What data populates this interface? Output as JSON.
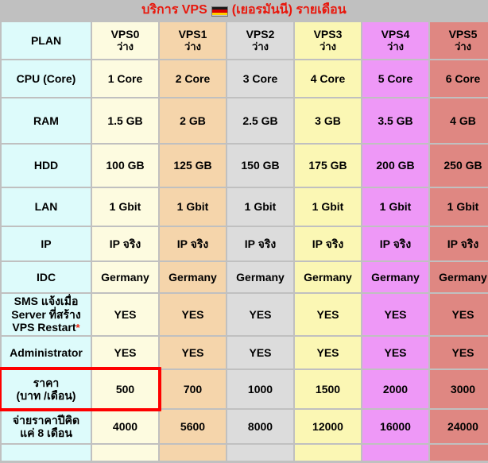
{
  "header": {
    "title_prefix": "บริการ VPS",
    "flag_icon": "german-flag-icon",
    "title_suffix": "(เยอรมันนี) รายเดือน",
    "accent_color": "#e8170c",
    "band_color": "#c0c0c0"
  },
  "columns": [
    {
      "key": "label",
      "name": "PLAN",
      "status": "",
      "color": "#ddfbfb"
    },
    {
      "key": "vps0",
      "name": "VPS0",
      "status": "ว่าง",
      "color": "#fdfbe0"
    },
    {
      "key": "vps1",
      "name": "VPS1",
      "status": "ว่าง",
      "color": "#f5d5ab"
    },
    {
      "key": "vps2",
      "name": "VPS2",
      "status": "ว่าง",
      "color": "#dcdcdc"
    },
    {
      "key": "vps3",
      "name": "VPS3",
      "status": "ว่าง",
      "color": "#fbf7b4"
    },
    {
      "key": "vps4",
      "name": "VPS4",
      "status": "ว่าง",
      "color": "#ee98f7"
    },
    {
      "key": "vps5",
      "name": "VPS5",
      "status": "ว่าง",
      "color": "#df8782"
    }
  ],
  "rows": [
    {
      "label": "CPU (Core)",
      "values": [
        "1 Core",
        "2 Core",
        "3 Core",
        "4 Core",
        "5 Core",
        "6 Core"
      ]
    },
    {
      "label": "RAM",
      "values": [
        "1.5 GB",
        "2 GB",
        "2.5 GB",
        "3 GB",
        "3.5 GB",
        "4 GB"
      ]
    },
    {
      "label": "HDD",
      "values": [
        "100 GB",
        "125 GB",
        "150 GB",
        "175 GB",
        "200 GB",
        "250 GB"
      ]
    },
    {
      "label": "LAN",
      "values": [
        "1 Gbit",
        "1 Gbit",
        "1 Gbit",
        "1 Gbit",
        "1 Gbit",
        "1 Gbit"
      ]
    },
    {
      "label": "IP",
      "values": [
        "IP จริง",
        "IP จริง",
        "IP จริง",
        "IP จริง",
        "IP จริง",
        "IP จริง"
      ]
    },
    {
      "label": "IDC",
      "values": [
        "Germany",
        "Germany",
        "Germany",
        "Germany",
        "Germany",
        "Germany"
      ]
    },
    {
      "label_lines": [
        "SMS แจ้งเมื่อ",
        "Server ที่สร้าง",
        "VPS Restart"
      ],
      "label_star": "*",
      "values": [
        "YES",
        "YES",
        "YES",
        "YES",
        "YES",
        "YES"
      ]
    },
    {
      "label": "Administrator",
      "values": [
        "YES",
        "YES",
        "YES",
        "YES",
        "YES",
        "YES"
      ]
    },
    {
      "label_lines": [
        "ราคา",
        "(บาท /เดือน)"
      ],
      "values": [
        "500",
        "700",
        "1000",
        "1500",
        "2000",
        "3000"
      ],
      "highlighted": true
    },
    {
      "label_lines": [
        "จ่ายราคาปีคิด",
        "แค่ 8 เดือน"
      ],
      "values": [
        "4000",
        "5600",
        "8000",
        "12000",
        "16000",
        "24000"
      ],
      "value_color": "#1517e0",
      "label_color": "#1517e0"
    }
  ],
  "highlight": {
    "color": "#fe0000",
    "note": "red box around monthly price label and VPS0 price"
  }
}
